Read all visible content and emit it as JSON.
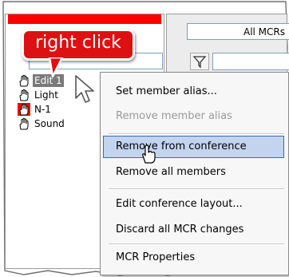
{
  "callout": {
    "text": "right click"
  },
  "mcr_dropdown": {
    "value": "All MCRs"
  },
  "tree": {
    "items": [
      {
        "label": "Edit 1",
        "selected": true
      },
      {
        "label": "Light"
      },
      {
        "label": "N-1",
        "flagged": true
      },
      {
        "label": "Sound"
      }
    ]
  },
  "context_menu": {
    "items": [
      {
        "label": "Set member alias..."
      },
      {
        "label": "Remove member alias",
        "disabled": true
      },
      {
        "label": "Remove from conference",
        "highlighted": true
      },
      {
        "label": "Remove all members"
      },
      {
        "label": "Edit conference layout..."
      },
      {
        "label": "Discard all MCR changes"
      },
      {
        "label": "MCR Properties"
      }
    ]
  },
  "colors": {
    "callout_red": "#dd1111",
    "panel_header_red": "#ff0000",
    "menu_highlight": "#c3d4ef",
    "menu_highlight_border": "#3a67b8"
  }
}
